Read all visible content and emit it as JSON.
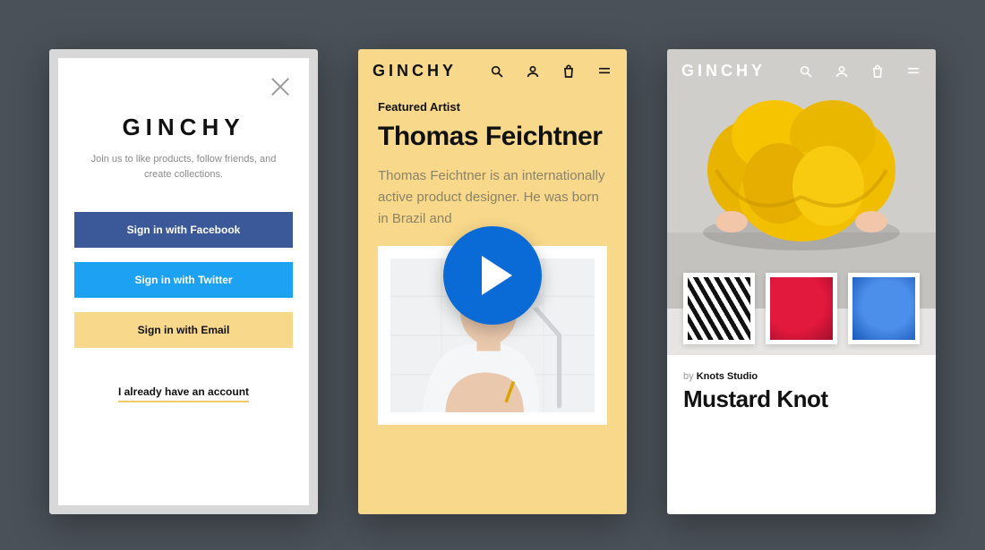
{
  "brand": "GINCHY",
  "screen1": {
    "tagline": "Join us to like products, follow friends, and create collections.",
    "btn_facebook": "Sign in with Facebook",
    "btn_twitter": "Sign in with Twitter",
    "btn_email": "Sign in with Email",
    "already": "I already have an account"
  },
  "screen2": {
    "overline": "Featured Artist",
    "headline": "Thomas Feichtner",
    "blurb": "Thomas Feichtner is an internationally active product designer. He was born in Brazil and"
  },
  "screen3": {
    "byline_prefix": "by ",
    "byline_author": "Knots Studio",
    "title": "Mustard Knot"
  },
  "icons": {
    "search": "search-icon",
    "user": "user-icon",
    "bag": "bag-icon",
    "menu": "menu-icon",
    "close": "close-icon",
    "play": "play-icon"
  },
  "colors": {
    "facebook": "#3b5998",
    "twitter": "#1da1f2",
    "email": "#f8d88a",
    "play": "#0b6bd6",
    "panel2": "#f8d88a"
  }
}
